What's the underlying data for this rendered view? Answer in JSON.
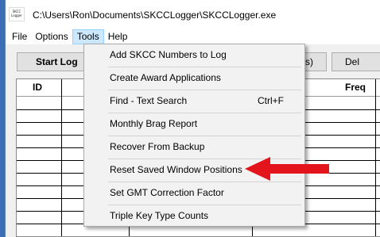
{
  "app_icon_text": "SKCC Logger",
  "window_title": "C:\\Users\\Ron\\Documents\\SKCCLogger\\SKCCLogger.exe",
  "menubar": {
    "file": "File",
    "options": "Options",
    "tools": "Tools",
    "help": "Help"
  },
  "toolbar": {
    "start_log_partial": "Start Log",
    "middle_partial": "w(s)",
    "right_partial": "Del"
  },
  "grid": {
    "columns": {
      "id": "ID",
      "freq": "Freq"
    }
  },
  "tools_menu": {
    "items": [
      {
        "label": "Add SKCC Numbers to Log",
        "shortcut": ""
      },
      {
        "label": "Create Award Applications",
        "shortcut": ""
      },
      {
        "label": "Find - Text Search",
        "shortcut": "Ctrl+F"
      },
      {
        "label": "Monthly Brag Report",
        "shortcut": ""
      },
      {
        "label": "Recover From Backup",
        "shortcut": ""
      },
      {
        "label": "Reset Saved Window Positions",
        "shortcut": ""
      },
      {
        "label": "Set GMT Correction Factor",
        "shortcut": ""
      },
      {
        "label": "Triple Key Type Counts",
        "shortcut": ""
      }
    ]
  },
  "annotation": {
    "arrow_color": "#e3141b",
    "points_to": "Reset Saved Window Positions"
  },
  "colors": {
    "desktop": "#3b6fb5",
    "menu_highlight": "#cce8ff",
    "button_face": "#e1e1e1"
  }
}
